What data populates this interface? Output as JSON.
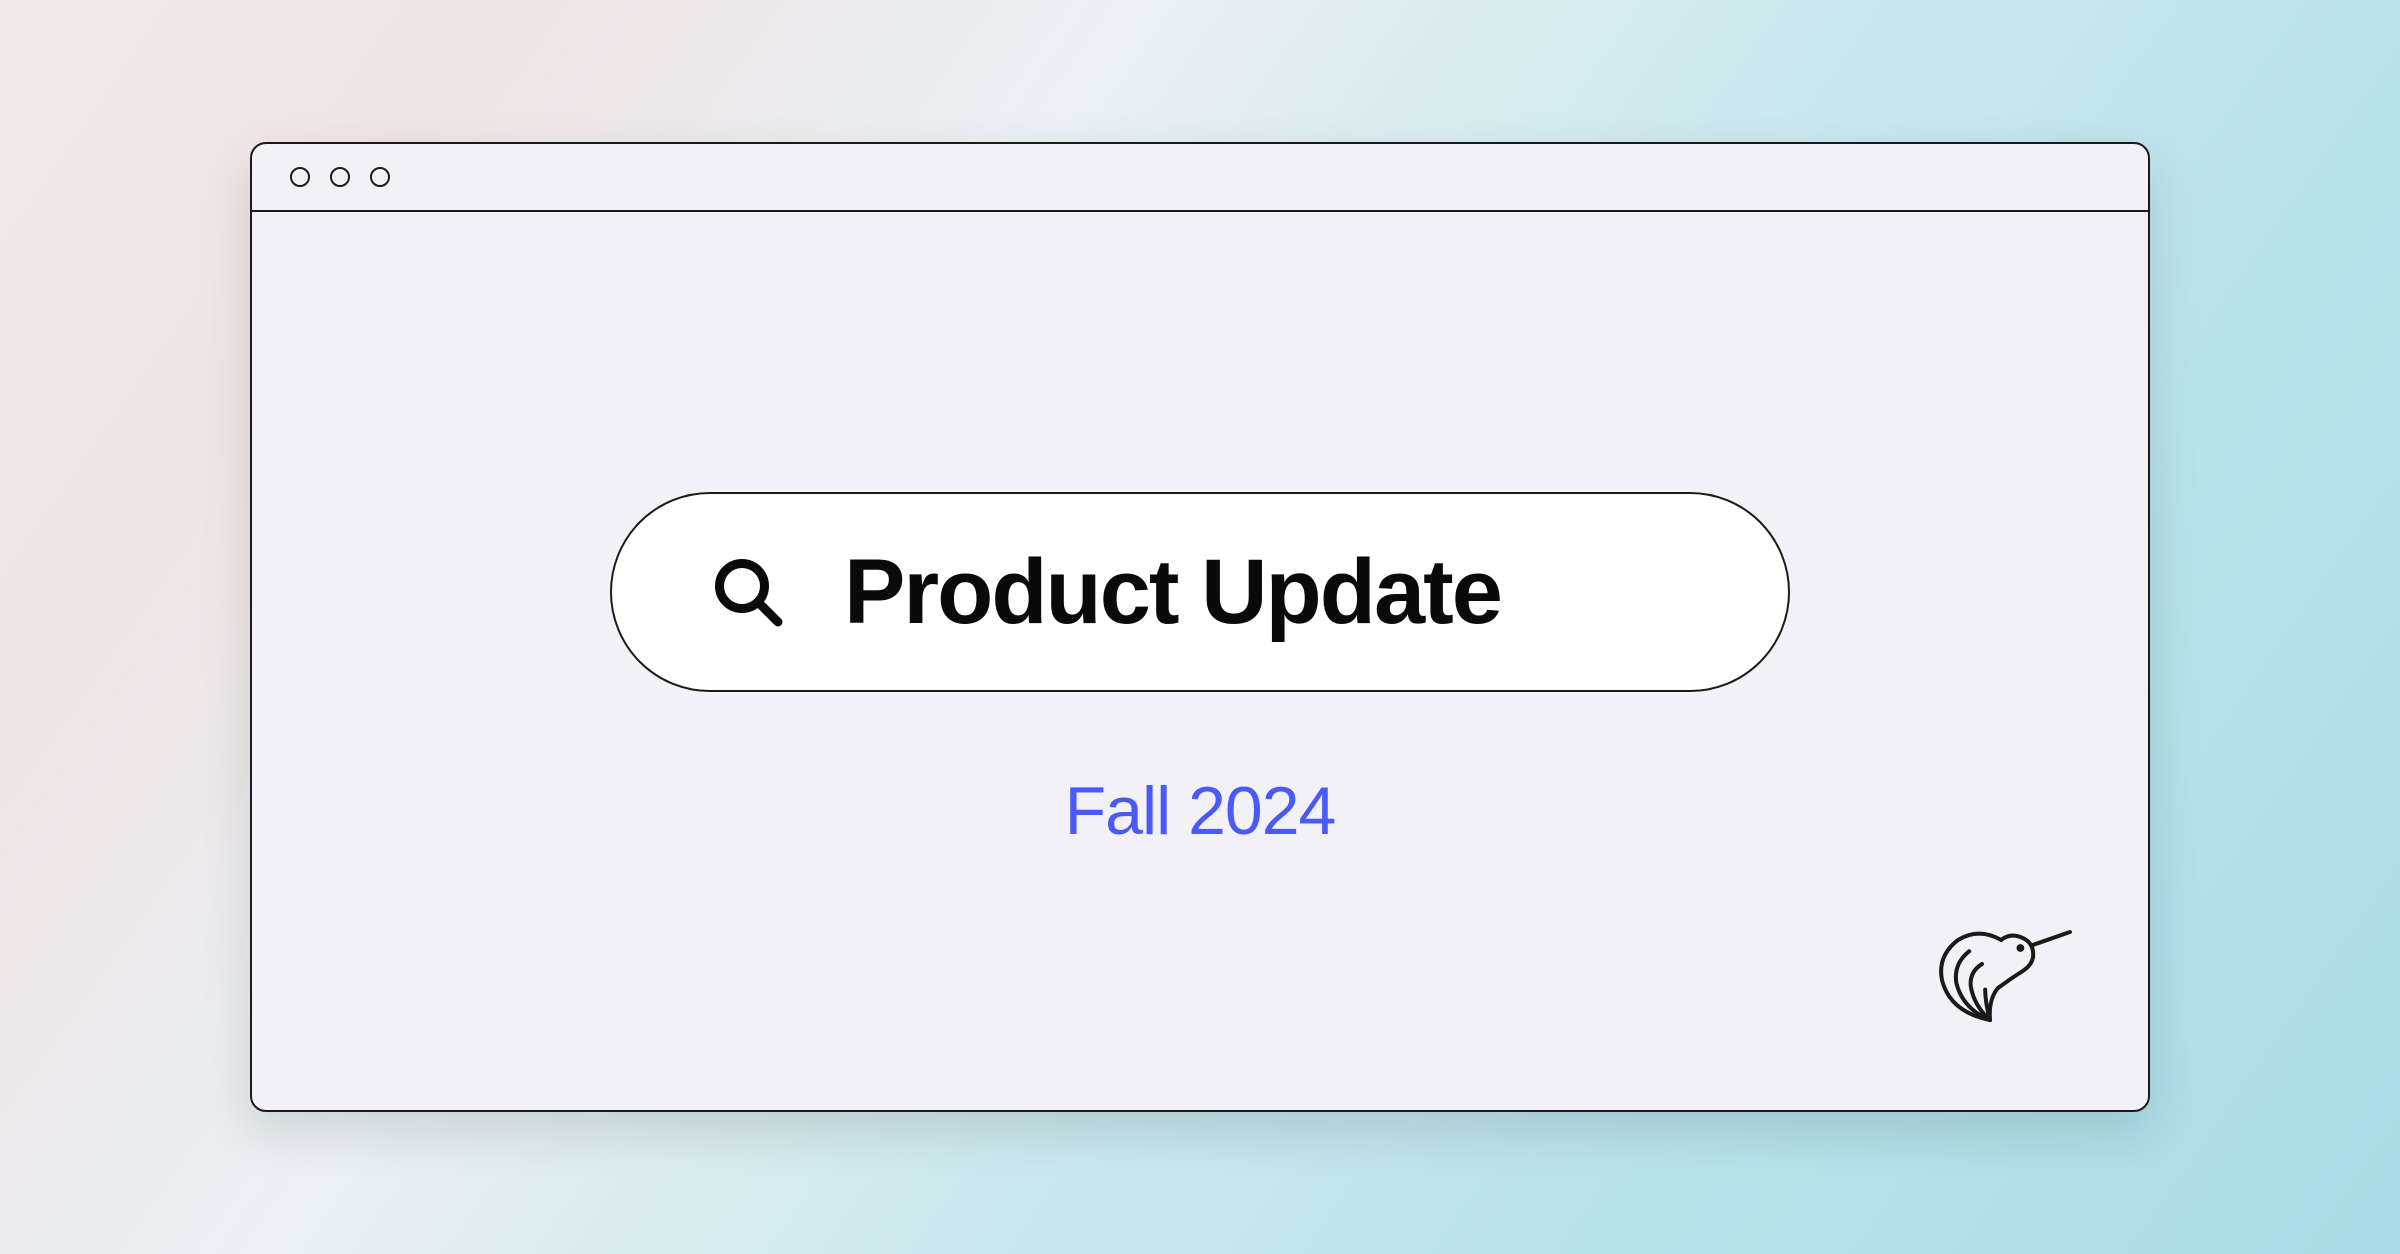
{
  "search": {
    "text": "Product Update"
  },
  "subtitle": "Fall 2024",
  "icons": {
    "search": "search-icon",
    "logo": "hummingbird-logo"
  }
}
